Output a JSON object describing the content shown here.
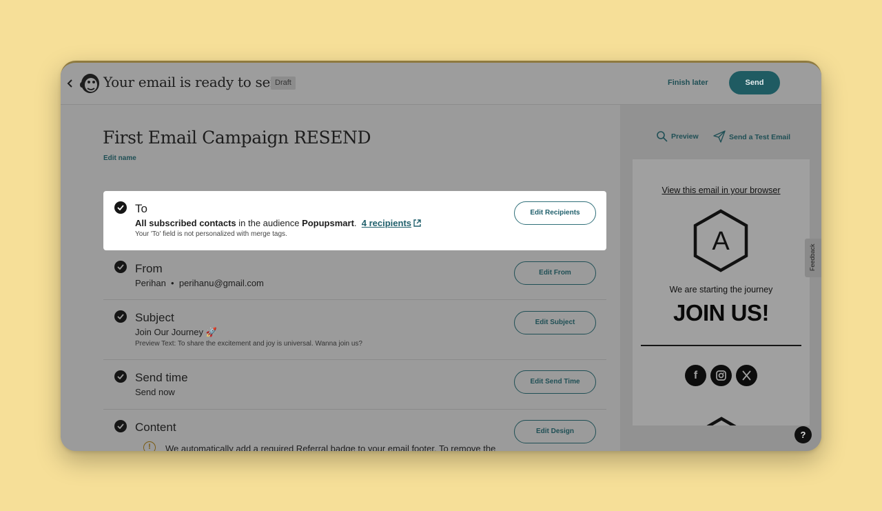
{
  "header": {
    "title": "Your email is ready to send!",
    "status_badge": "Draft",
    "finish_later": "Finish later",
    "send": "Send"
  },
  "campaign": {
    "name": "First Email Campaign RESEND",
    "edit_name": "Edit name"
  },
  "checklist": {
    "to": {
      "heading": "To",
      "audience_bold": "All subscribed contacts",
      "audience_mid": " in the audience ",
      "audience_name": "Popupsmart",
      "audience_dot": ".",
      "recipients_link": "4 recipients",
      "note": "Your 'To' field is not personalized with merge tags.",
      "button": "Edit Recipients"
    },
    "from": {
      "heading": "From",
      "name": "Perihan",
      "separator": "•",
      "email": "perihanu@gmail.com",
      "button": "Edit From"
    },
    "subject": {
      "heading": "Subject",
      "value": "Join Our Journey 🚀",
      "preview_text": "Preview Text: To share the excitement and joy is universal. Wanna join us?",
      "button": "Edit Subject"
    },
    "send_time": {
      "heading": "Send time",
      "value": "Send now",
      "button": "Edit Send Time"
    },
    "content": {
      "heading": "Content",
      "warning": "We automatically add a required Referral badge to your email footer. To remove the",
      "button": "Edit Design"
    }
  },
  "preview_pane": {
    "preview": "Preview",
    "send_test": "Send a Test Email",
    "email": {
      "view_in_browser": "View this email in your browser",
      "logo_letter": "A",
      "tagline": "We are starting the journey",
      "headline": "JOIN US!",
      "social_icons": [
        "facebook-icon",
        "instagram-icon",
        "x-icon"
      ]
    }
  },
  "feedback_tab": "Feedback",
  "help": "?",
  "colors": {
    "background": "#f6df98",
    "accent": "#1f5b62",
    "overlay": "#9b9b9b"
  }
}
